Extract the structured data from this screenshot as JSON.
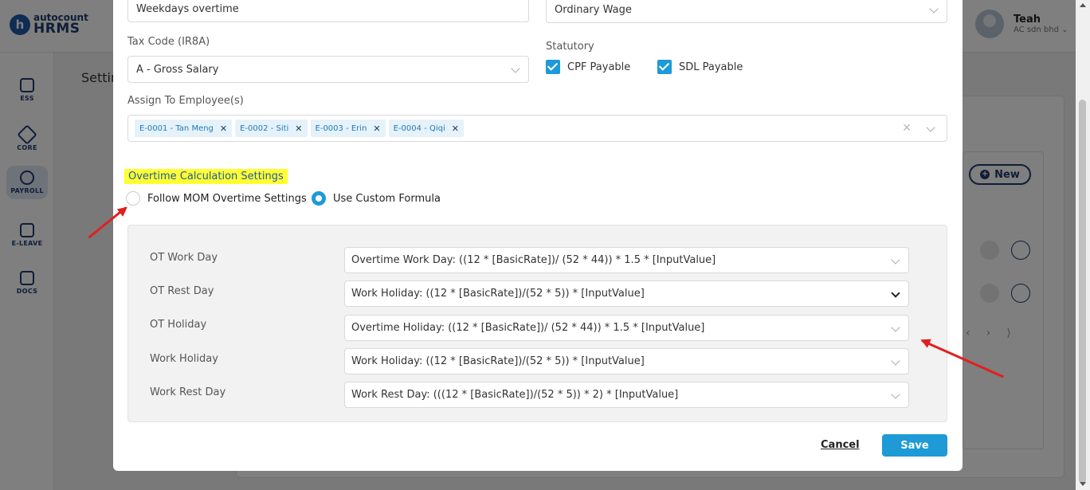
{
  "app": {
    "logo_top": "autocount",
    "logo_bottom": "HRMS",
    "logo_badge": "h",
    "user_name": "Teah",
    "company": "AC sdn bhd ⌄"
  },
  "sidenav": [
    {
      "label": "ESS",
      "icon": "ess-icon"
    },
    {
      "label": "CORE",
      "icon": "core-icon"
    },
    {
      "label": "PAYROLL",
      "icon": "payroll-icon"
    },
    {
      "label": "E-LEAVE",
      "icon": "calendar-icon"
    },
    {
      "label": "DOCS",
      "icon": "docs-icon"
    }
  ],
  "background": {
    "page_title": "Settin",
    "new_button": "New"
  },
  "form": {
    "name_value": "Weekdays overtime",
    "wage_type_value": "Ordinary Wage",
    "tax_code_label": "Tax Code (IR8A)",
    "tax_code_value": "A - Gross Salary",
    "statutory_label": "Statutory",
    "cpf_label": "CPF Payable",
    "sdl_label": "SDL Payable",
    "assign_label": "Assign To Employee(s)",
    "employees": [
      "E-0001 - Tan Meng",
      "E-0002 - Siti",
      "E-0003 - Erin",
      "E-0004 - Qiqi"
    ],
    "ot_section_title": "Overtime Calculation Settings",
    "radio_mom": "Follow MOM Overtime Settings",
    "radio_custom": "Use Custom Formula"
  },
  "formulas": [
    {
      "label": "OT Work Day",
      "value": "Overtime Work Day: ((12 * [BasicRate])/ (52 * 44)) * 1.5 * [InputValue]"
    },
    {
      "label": "OT Rest Day",
      "value": "Work Holiday: ((12 * [BasicRate])/(52 * 5)) * [InputValue]"
    },
    {
      "label": "OT Holiday",
      "value": "Overtime Holiday: ((12 * [BasicRate])/ (52 * 44)) * 1.5 * [InputValue]"
    },
    {
      "label": "Work Holiday",
      "value": "Work Holiday: ((12 * [BasicRate])/(52 * 5)) * [InputValue]"
    },
    {
      "label": "Work Rest Day",
      "value": "Work Rest Day: (((12 * [BasicRate])/(52 * 5)) * 2) * [InputValue]"
    }
  ],
  "buttons": {
    "cancel": "Cancel",
    "save": "Save"
  },
  "colors": {
    "accent": "#1e9ad6",
    "brand": "#1e3a6e",
    "highlight": "#ffff33",
    "annotation_arrow": "#e02020"
  }
}
